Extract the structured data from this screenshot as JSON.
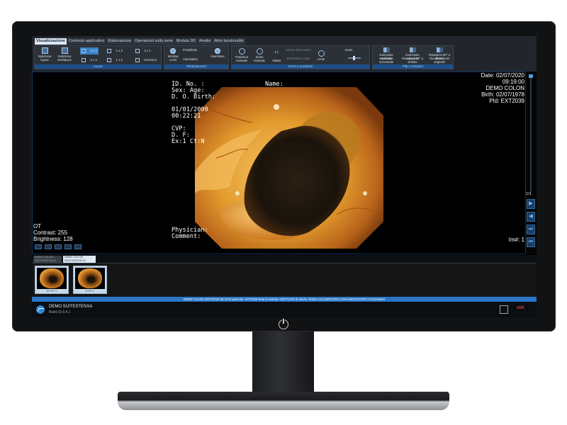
{
  "ribbon": {
    "tabs": [
      "Visualizzazione",
      "Contesto applicativo",
      "Elaborazione",
      "Operazioni sulla serie",
      "Modulo 3D",
      "Analisi",
      "Altre funzionalità"
    ],
    "layout_group": {
      "label": "Layout",
      "buttons": [
        "Seleziona layout",
        "Seleziona workspace"
      ],
      "cells": [
        "1 x 1",
        "1 x 2",
        "2 x 1",
        "2 x 2",
        "1 x 2",
        "Generico"
      ]
    },
    "window_group": {
      "label": "Window/Level",
      "buttons": [
        "Window Level",
        "Predefinito",
        "Automatico",
        "Inversione"
      ]
    },
    "zoom_group": {
      "label": "Zoom e posizione",
      "buttons": [
        "Posizione manuale",
        "Zoom manuale",
        "1:1",
        "Adatta",
        "Stessa dimensione",
        "Dimensione reale",
        "Lente",
        "Zoom"
      ]
    },
    "flip_group": {
      "label": "Flip e rotazioni",
      "buttons": [
        "Inversione verticale",
        "Inversione completa",
        "Rotazione 90° a destra",
        "Inversione orizzontale",
        "Rotazione 90° a sinistra",
        "Visualizzazione originale"
      ]
    }
  },
  "viewer": {
    "overlay_left": [
      "ID. No. :",
      "Sex:  Age:",
      "D. O. Birth:",
      "",
      "01/01/2000",
      "00:22:21",
      "",
      "CVP:",
      "D. F:",
      "Ex:1 Ct:N"
    ],
    "overlay_name": "Name:",
    "overlay_bottom": [
      "Physician:",
      "Comment:"
    ],
    "info_right": [
      "Date: 02/07/2020",
      "09:19:00",
      "DEMO COLON",
      "Birth: 02/07/1978",
      "PId: EXT2039"
    ],
    "info_left": [
      "OT",
      "Contrast: 255",
      "Brightness: 128"
    ],
    "image_number": "Im#: 1",
    "counter": "1/1"
  },
  "series_tabs": [
    {
      "line1": "DEMO COLON",
      "line2": "02/07/2020 09:19"
    },
    {
      "line1": "DEMO COLON",
      "line2": "02/07/2020 09:19"
    }
  ],
  "thumbnails": [
    {
      "label": "37 OT: 1"
    },
    {
      "label": "6 OT: 1"
    }
  ],
  "patient_bar": "DEMO COLON 02/07/2020 09:19 ID paziente: EXT2039 Data di nascita: 02/07/1978 ID studio: RIS52 COLONSCOPIA CON ENDOSCOPIO FLESSIBILE",
  "status": {
    "app_name": "DEMO SUITESTENSA",
    "build": "Build 33.6.4.1",
    "vendor": "ebit"
  },
  "colors": {
    "ribbon_bg": "#22262c",
    "accent": "#2b76c7",
    "viewer_bg": "#000000"
  }
}
